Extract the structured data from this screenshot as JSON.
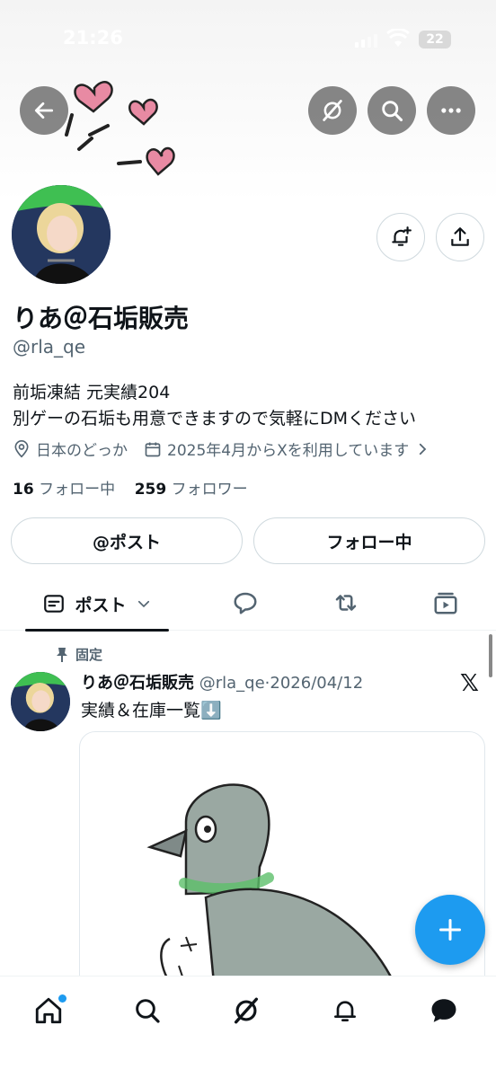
{
  "status_bar": {
    "time": "21:26",
    "battery": "22"
  },
  "profile": {
    "name": "りあ＠石垢販売",
    "handle": "@rla_qe",
    "bio_lines": [
      "前垢凍結 元実績204",
      "別ゲーの石垢も用意できますので気軽にDMください"
    ],
    "location": "日本のどっか",
    "joined": "2025年4月からXを利用しています",
    "following_count": "16",
    "following_label": "フォロー中",
    "followers_count": "259",
    "followers_label": "フォロワー"
  },
  "actions": {
    "mention_button": "@ポスト",
    "following_button": "フォロー中"
  },
  "tabs": {
    "active_label": "ポスト"
  },
  "pinned_post": {
    "pinned_label": "固定",
    "author": "りあ＠石垢販売",
    "handle": "@rla_qe",
    "separator": "·",
    "date": "2026/04/12",
    "text": "実績＆在庫一覧⬇️",
    "badge": "𝕏"
  },
  "icons": {
    "back": "back-arrow-icon",
    "grok": "grok-icon",
    "search": "search-icon",
    "more": "more-icon",
    "notify": "notification-bell-icon",
    "share": "share-icon",
    "location": "location-pin-icon",
    "calendar": "calendar-icon",
    "reply": "reply-icon",
    "repost": "repost-icon",
    "media": "media-icon",
    "compose": "compose-plus-icon",
    "home": "home-icon",
    "bell": "bell-icon",
    "messages": "messages-icon"
  },
  "colors": {
    "accent": "#1d9bf0",
    "text": "#0f1419",
    "muted": "#536471",
    "heart": "#e88aa3"
  }
}
